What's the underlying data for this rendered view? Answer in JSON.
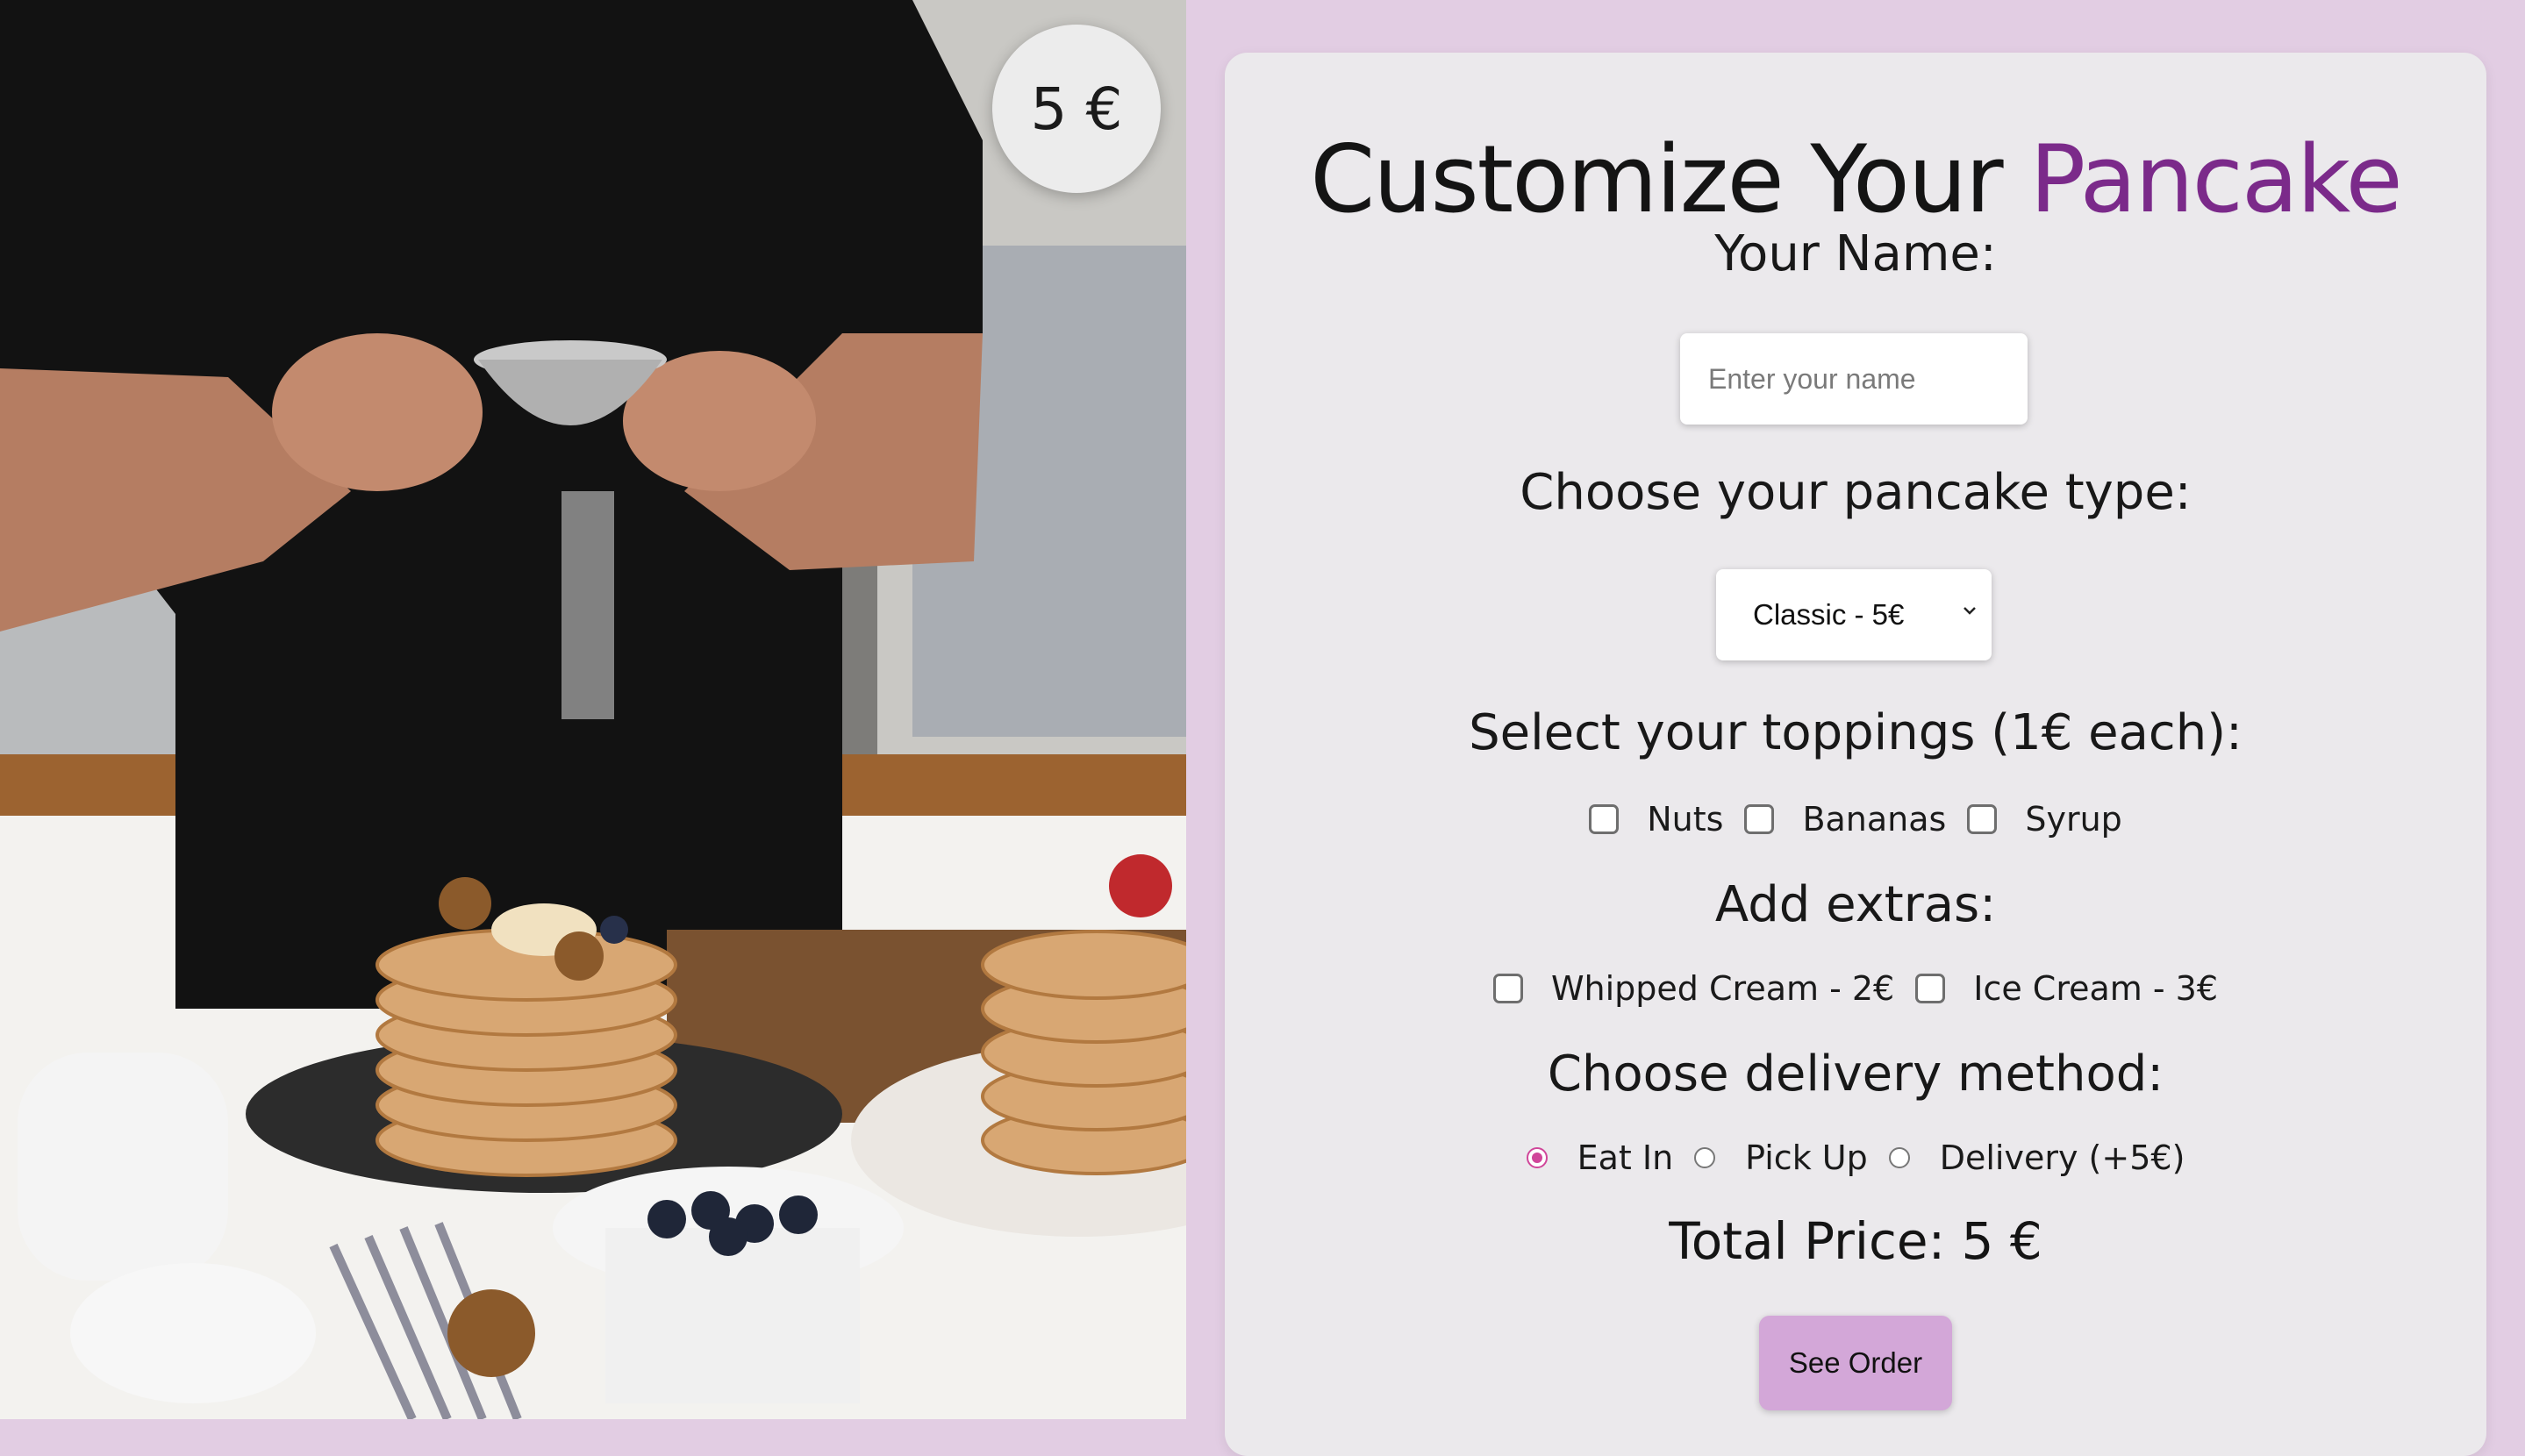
{
  "hero": {
    "price_badge": "5 €"
  },
  "form": {
    "title_main": "Customize Your",
    "title_accent": "Pancake",
    "name_label": "Your Name:",
    "name_placeholder": "Enter your name",
    "name_value": "",
    "type_label": "Choose your pancake type:",
    "type_selected": "Classic - 5€",
    "toppings_label": "Select your toppings (1€ each):",
    "toppings": [
      {
        "label": "Nuts",
        "checked": false
      },
      {
        "label": "Bananas",
        "checked": false
      },
      {
        "label": "Syrup",
        "checked": false
      }
    ],
    "extras_label": "Add extras:",
    "extras": [
      {
        "label": "Whipped Cream - 2€",
        "checked": false
      },
      {
        "label": "Ice Cream - 3€",
        "checked": false
      }
    ],
    "delivery_label": "Choose delivery method:",
    "delivery": [
      {
        "label": "Eat In",
        "checked": true
      },
      {
        "label": "Pick Up",
        "checked": false
      },
      {
        "label": "Delivery (+5€)",
        "checked": false
      }
    ],
    "total_text": "Total Price: 5 €",
    "submit_label": "See Order"
  },
  "colors": {
    "page_background": "#e2cde3",
    "card_background": "#ebe9ec",
    "title_accent": "#7b2a8a",
    "button": "#d3a7d8",
    "radio_checked": "#d0469a"
  }
}
